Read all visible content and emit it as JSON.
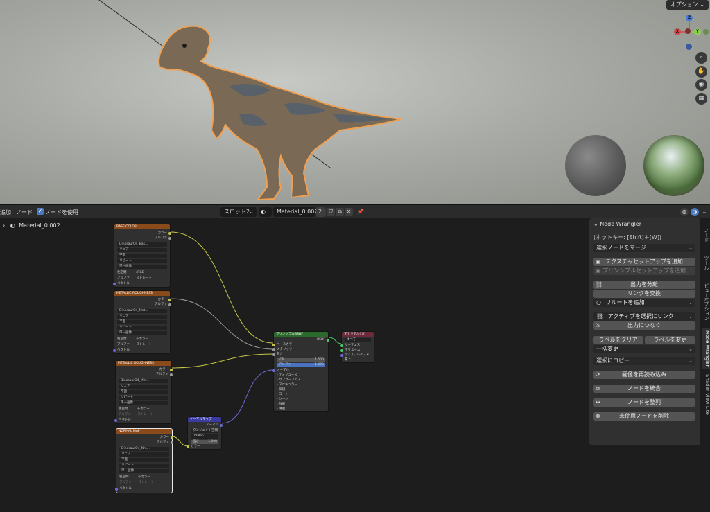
{
  "viewport": {
    "options_label": "オプション"
  },
  "gizmo": {
    "x": "X",
    "y": "Y",
    "z": "Z"
  },
  "header": {
    "menu_add": "追加",
    "menu_node": "ノード",
    "use_nodes_label": "ノードを使用",
    "slot_label": "スロット2",
    "material_name": "Material_0.002",
    "user_count": "2"
  },
  "tree": {
    "material": "Material_0.002"
  },
  "nodes": {
    "tex1": {
      "title": "BASE COLOR",
      "out_color": "カラー",
      "out_alpha": "アルファ",
      "image": "DinosaurO4_Bas...",
      "interp": "リニア",
      "proj": "平面",
      "ext": "リピート",
      "src": "単一画像",
      "cs_label": "色空間",
      "cs": "sRGB",
      "alpha_label": "アルファ",
      "alpha": "ストレート",
      "vec": "ベクトル"
    },
    "tex2": {
      "title": "METALLIC ROUGHNESS",
      "out_color": "カラー",
      "out_alpha": "アルファ",
      "image": "DinosaurO4_Met...",
      "interp": "リニア",
      "proj": "平面",
      "ext": "リピート",
      "src": "単一画像",
      "cs_label": "色空間",
      "cs": "非カラー",
      "alpha_label": "アルファ",
      "alpha": "ストレート",
      "vec": "ベクトル"
    },
    "tex3": {
      "title": "METALLIC ROUGHNESS",
      "out_color": "カラー",
      "out_alpha": "アルファ",
      "image": "DinosaurO4_Met...",
      "interp": "リニア",
      "proj": "平面",
      "ext": "リピート",
      "src": "単一画像",
      "cs_label": "色空間",
      "cs": "非カラー",
      "alpha_label": "アルファ",
      "alpha": "ストレート",
      "vec": "ベクトル"
    },
    "tex4": {
      "title": "NORMAL MAP",
      "out_color": "カラー",
      "out_alpha": "アルファ",
      "image": "DinosaurO4_Nro...",
      "interp": "リニア",
      "proj": "平面",
      "ext": "リピート",
      "src": "単一画像",
      "cs_label": "色空間",
      "cs": "非カラー",
      "alpha_label": "アルファ",
      "alpha": "ストレート",
      "vec": "ベクトル"
    },
    "bsdf": {
      "title": "プリンシプルBSDF",
      "out": "BSDF",
      "base": "ベースカラー",
      "metal": "メタリック",
      "rough": "粗さ",
      "ior_label": "IOR",
      "ior": "1.500",
      "alpha_label": "アルファ",
      "alpha": "1.000",
      "normal": "ノーマル",
      "diffuse": "ディフューズ",
      "sss": "サブサーフェス",
      "spec": "スペキュラー",
      "trans": "伝播",
      "coat": "コート",
      "sheen": "シーン",
      "emis": "放射",
      "thin": "薄膜"
    },
    "output": {
      "title": "マテリアル出力",
      "target": "すべて",
      "surface": "サーフェス",
      "volume": "ボリューム",
      "disp": "ディスプレイスメント",
      "thick": "厚"
    },
    "normal": {
      "title": "ノーマルマップ",
      "out": "ノーマル",
      "space": "タンジェント空間",
      "uv": "UVMap",
      "str_label": "強さ",
      "str": "1.000",
      "color": "カラー"
    }
  },
  "npanel": {
    "title": "Node Wrangler",
    "hotkey": "(ホットキー: [Shift]＋[W])",
    "merge": "選択ノードをマージ",
    "tex_setup": "テクスチャセットアップを追加",
    "principled_setup": "プリンシプルセットアップを追加",
    "split_out": "出力を分離",
    "swap_links": "リンクを交換",
    "add_reroute": "リルートを追加",
    "link_active": "アクティブを選択にリンク",
    "connect_out": "出力につなぐ",
    "clear_label": "ラベルをクリア",
    "modify_label": "ラベルを変更",
    "batch": "一括変更",
    "copy_sel": "選択にコピー",
    "reload": "画像を再読み込み",
    "merge_nodes": "ノードを統合",
    "align": "ノードを整列",
    "delete_unused": "未使用ノードを削除"
  },
  "side_tabs": [
    "ノード",
    "ツール",
    "ビュー",
    "オプション",
    "Node Wrangler",
    "Shader View Lite"
  ]
}
